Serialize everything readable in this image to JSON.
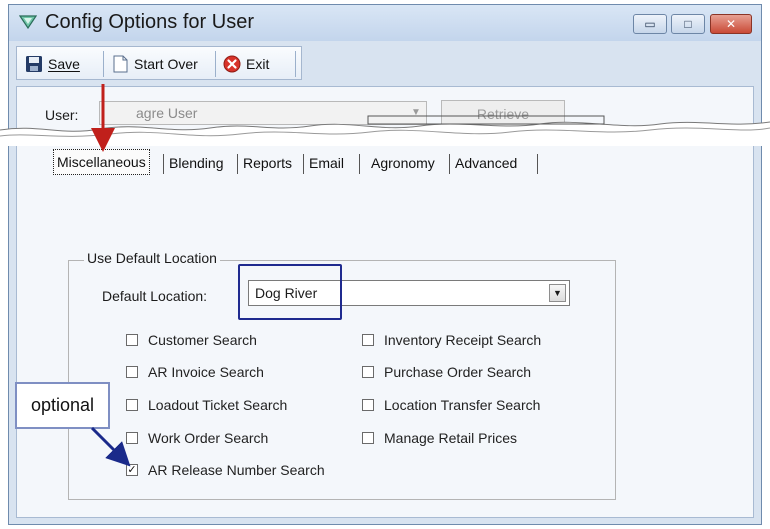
{
  "window": {
    "title": "Config Options for User"
  },
  "window_controls": {
    "minimize": "▭",
    "maximize": "□",
    "close": "✕"
  },
  "toolbar": {
    "save_label": "Save",
    "start_over_label": "Start Over",
    "exit_label": "Exit"
  },
  "user": {
    "label": "User:",
    "value": "agre User",
    "retrieve_label": "Retrieve"
  },
  "tabs": [
    "Miscellaneous",
    "Blending",
    "Reports",
    "Email",
    "Agronomy",
    "Advanced"
  ],
  "group": {
    "legend": "Use Default Location",
    "location_label": "Default Location:",
    "location_value": "Dog River"
  },
  "checkboxes": [
    {
      "label": "Customer Search",
      "checked": false
    },
    {
      "label": "AR Invoice Search",
      "checked": false
    },
    {
      "label": "Loadout Ticket Search",
      "checked": false
    },
    {
      "label": "Work Order Search",
      "checked": false
    },
    {
      "label": "AR Release Number Search",
      "checked": true
    },
    {
      "label": "Inventory Receipt Search",
      "checked": false
    },
    {
      "label": "Purchase Order Search",
      "checked": false
    },
    {
      "label": "Location Transfer Search",
      "checked": false
    },
    {
      "label": "Manage Retail Prices",
      "checked": false
    }
  ],
  "callout": {
    "text": "optional"
  },
  "colors": {
    "highlight_box": "#1f2a8f",
    "red_arrow": "#c0201b",
    "blue_arrow": "#1a2a8a"
  }
}
